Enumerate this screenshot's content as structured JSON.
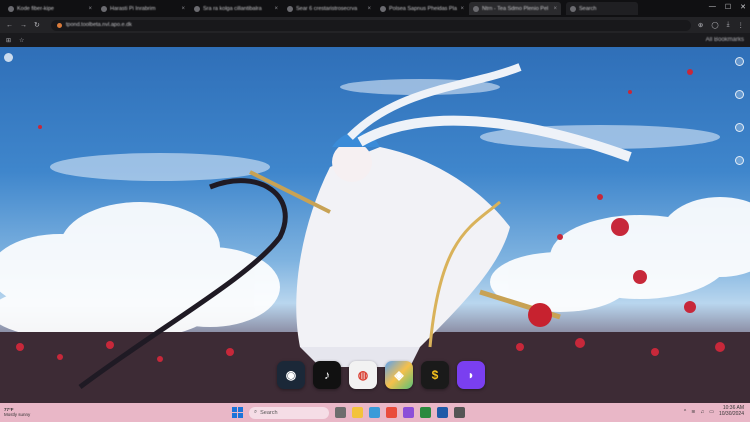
{
  "browser": {
    "tabs": [
      {
        "label": "Kode fiber-kipe",
        "active": false
      },
      {
        "label": "Harasti Pi Inrabrim",
        "active": false
      },
      {
        "label": "Sra ra kolga cillantibalra",
        "active": false
      },
      {
        "label": "Sear 6 crestaristrosecrva",
        "active": false
      },
      {
        "label": "Polsea Sapnus Pheidas Pla",
        "active": false
      },
      {
        "label": "Ntrn - Tea Sdmo Plenio Pel",
        "active": true
      }
    ],
    "search_tab_label": "Search",
    "address": "tpond.toolbeta.nvl.apo.e.dk",
    "bookmarks_right_label": "All Bookmarks"
  },
  "dock": {
    "apps": [
      {
        "name": "steam-app",
        "glyph": "◉"
      },
      {
        "name": "tiktok-app",
        "glyph": "♪"
      },
      {
        "name": "chrome-app",
        "glyph": "◍"
      },
      {
        "name": "maps-app",
        "glyph": "◈"
      },
      {
        "name": "coin-app",
        "glyph": "$"
      },
      {
        "name": "purple-app",
        "glyph": "◗"
      }
    ]
  },
  "taskbar": {
    "weather_temp": "77°F",
    "weather_text": "Mostly sunny",
    "search_placeholder": "Search",
    "time": "10:36 AM",
    "date": "10/30/2024"
  },
  "colors": {
    "accent": "#1b74d9",
    "taskbar_bg": "#e9b7c7",
    "sky": "#3f86cc"
  }
}
